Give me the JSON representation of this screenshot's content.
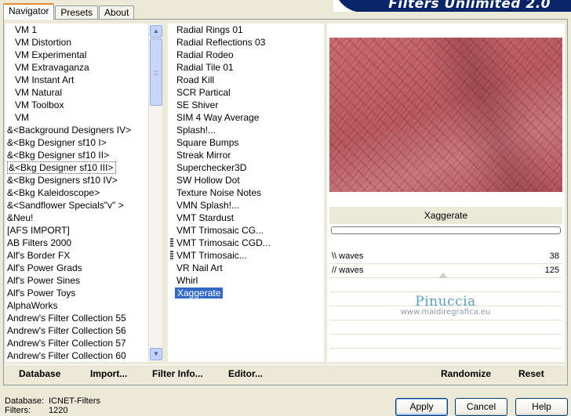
{
  "banner": {
    "title": "Filters Unlimited 2.0"
  },
  "tabs": [
    {
      "label": "Navigator",
      "active": true
    },
    {
      "label": "Presets",
      "active": false
    },
    {
      "label": "About",
      "active": false
    }
  ],
  "categories": {
    "items": [
      "VM 1",
      "VM Distortion",
      "VM Experimental",
      "VM Extravaganza",
      "VM Instant Art",
      "VM Natural",
      "VM Toolbox",
      "VM",
      "&<Background Designers IV>",
      "&<Bkg Designer sf10 I>",
      "&<Bkg Designer sf10 II>",
      "&<Bkg Designer sf10 III>",
      "&<Bkg Designers sf10 IV>",
      "&<Bkg Kaleidoscope>",
      "&<Sandflower Specials\"v\" >",
      "&Neu!",
      "[AFS IMPORT]",
      "AB Filters 2000",
      "Alf's Border FX",
      "Alf's Power Grads",
      "Alf's Power Sines",
      "Alf's Power Toys",
      "AlphaWorks",
      "Andrew's Filter Collection 55",
      "Andrew's Filter Collection 56",
      "Andrew's Filter Collection 57",
      "Andrew's Filter Collection 60"
    ],
    "selected_index": 11
  },
  "filters": {
    "items": [
      "Radial  Rings 01",
      "Radial Reflections 03",
      "Radial Rodeo",
      "Radial Tile 01",
      "Road Kill",
      "SCR  Partical",
      "SE Shiver",
      "SIM 4 Way Average",
      "Splash!...",
      "Square Bumps",
      "Streak Mirror",
      "Superchecker3D",
      "SW Hollow Dot",
      "Texture Noise Notes",
      "VMN Splash!...",
      "VMT Stardust",
      "VMT Trimosaic CG...",
      "VMT Trimosaic CGD...",
      "VMT Trimosaic...",
      "VR Nail Art",
      "Whirl",
      "Xaggerate"
    ],
    "selected_index": 21,
    "grip_indices": [
      17,
      18
    ]
  },
  "preview": {
    "filter_name": "Xaggerate"
  },
  "controls": [
    {
      "label": "\\\\ waves",
      "value": "38"
    },
    {
      "label": "// waves",
      "value": "125"
    }
  ],
  "watermark": {
    "title": "Pinuccia",
    "url": "www.maidiregrafica.eu"
  },
  "bottom_bar": {
    "database": "Database",
    "import": "Import...",
    "filter_info": "Filter Info...",
    "editor": "Editor...",
    "randomize": "Randomize",
    "reset": "Reset"
  },
  "status": {
    "database_label": "Database:",
    "database_value": "ICNET-Filters",
    "filters_label": "Filters:",
    "filters_value": "1220"
  },
  "buttons": {
    "apply": "Apply",
    "cancel": "Cancel",
    "help": "Help"
  }
}
